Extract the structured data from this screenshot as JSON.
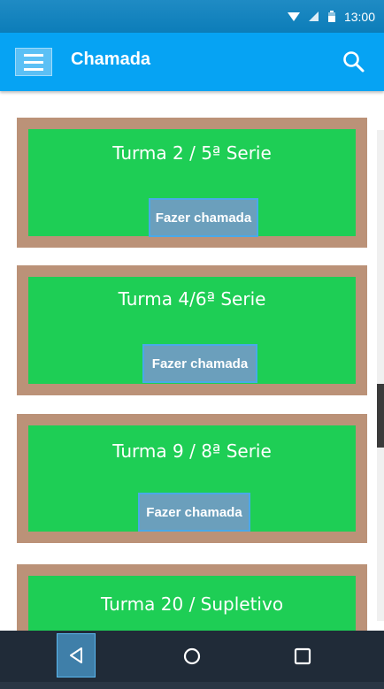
{
  "status_bar": {
    "time": "13:00"
  },
  "app_bar": {
    "title": "Chamada"
  },
  "classes": [
    {
      "title": "Turma 2 / 5ª Serie",
      "button": "Fazer chamada"
    },
    {
      "title": "Turma 4/6ª Serie",
      "button": "Fazer chamada"
    },
    {
      "title": "Turma 9 / 8ª Serie",
      "button": "Fazer chamada"
    },
    {
      "title": "Turma 20 /  Supletivo",
      "button": ""
    }
  ],
  "icons": {
    "menu": "hamburger-menu-icon",
    "search": "search-icon",
    "back": "back-triangle-icon",
    "home": "home-circle-icon",
    "recent": "recent-apps-square-icon",
    "wifi": "wifi-icon",
    "signal": "signal-icon",
    "battery": "battery-icon"
  },
  "colors": {
    "app_bar": "#06a3f3",
    "card_frame": "#bb9278",
    "card_fill": "#1ece55",
    "button": "#6b9fbc",
    "nav_bar": "#202b38"
  }
}
